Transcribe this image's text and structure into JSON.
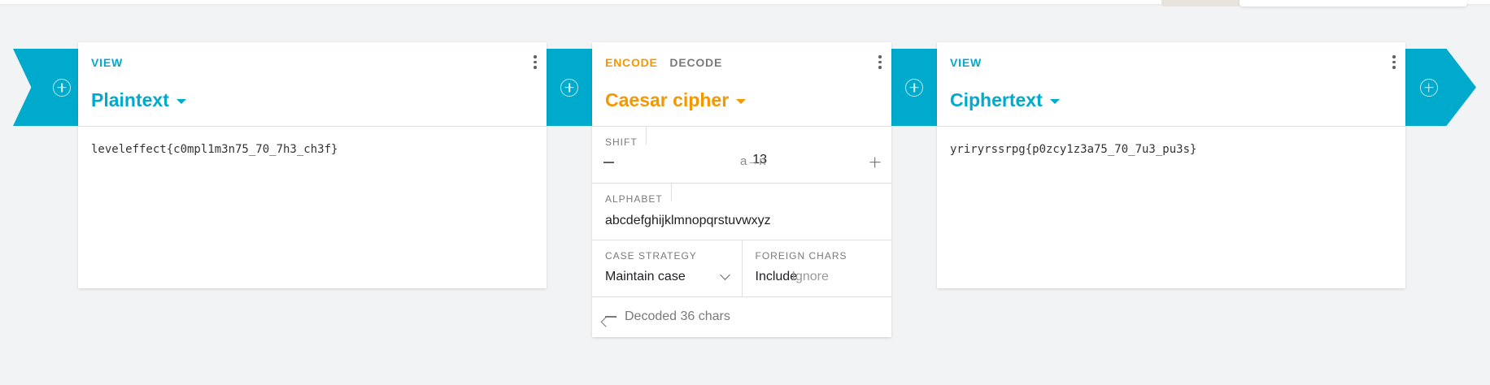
{
  "cards": [
    {
      "modes": [
        "VIEW"
      ],
      "title": "Plaintext",
      "content": "leveleffect{c0mpl1m3n75_70_7h3_ch3f}"
    },
    {
      "modes": [
        "ENCODE",
        "DECODE"
      ],
      "title": "Caesar cipher",
      "shift": {
        "label": "SHIFT",
        "value": "13",
        "hint": "a→n"
      },
      "alphabet": {
        "label": "ALPHABET",
        "value": "abcdefghijklmnopqrstuvwxyz"
      },
      "case_strategy": {
        "label": "CASE STRATEGY",
        "value": "Maintain case"
      },
      "foreign_chars": {
        "label": "FOREIGN CHARS",
        "options": [
          "Include",
          "Ignore"
        ],
        "selected": "Include"
      },
      "status": "Decoded 36 chars"
    },
    {
      "modes": [
        "VIEW"
      ],
      "title": "Ciphertext",
      "content": "yriryrssrpg{p0zcy1z3a75_70_7u3_pu3s}"
    }
  ],
  "colors": {
    "accent_cyan": "#00aacc",
    "accent_orange": "#f59700"
  },
  "icons": [
    "add-circle-icon",
    "more-vert-icon",
    "dropdown-caret-icon",
    "minus-icon",
    "plus-icon",
    "chevron-down-icon",
    "arrow-left-icon"
  ]
}
